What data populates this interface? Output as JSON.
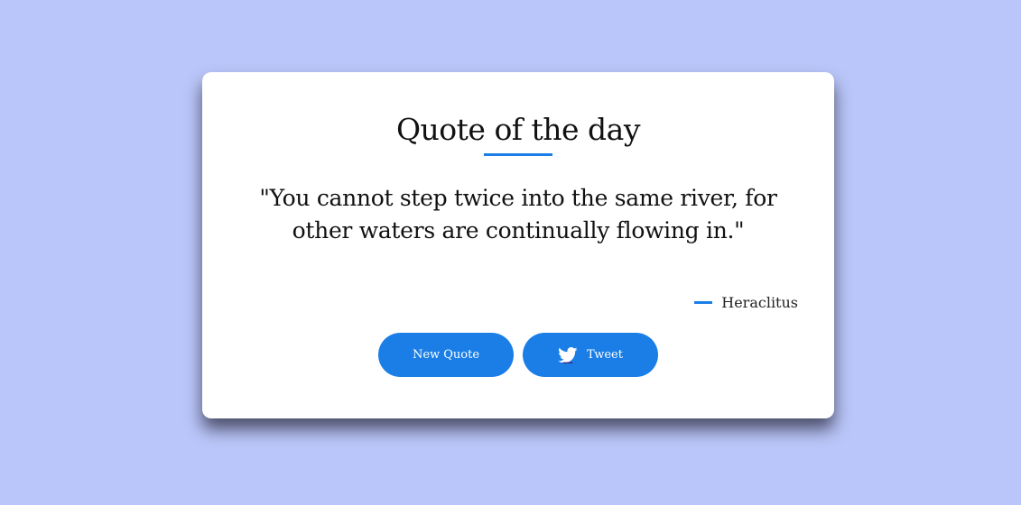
{
  "card": {
    "title": "Quote of the day",
    "quote": "\"You cannot step twice into the same river, for other waters are continually flowing in.\"",
    "author": "Heraclitus"
  },
  "buttons": {
    "new_quote_label": "New Quote",
    "tweet_label": "Tweet"
  },
  "colors": {
    "background": "#bac6f9",
    "accent": "#1a7ee6",
    "card": "#ffffff"
  },
  "icons": {
    "tweet_icon": "twitter-bird-icon"
  }
}
